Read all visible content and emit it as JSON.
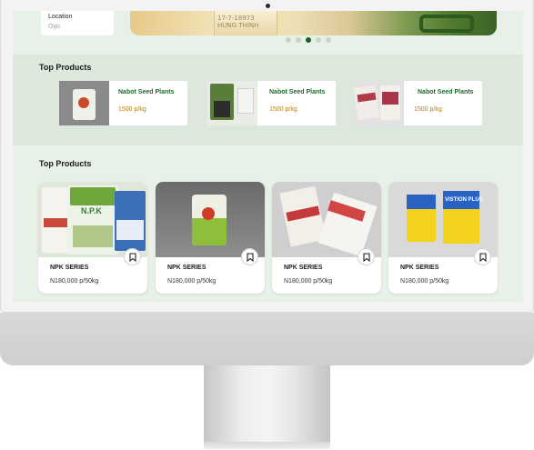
{
  "location": {
    "label": "Location",
    "value": "Oyo"
  },
  "banner": {
    "text_line1": "17-7-18973",
    "text_line2": "HUNG THINH"
  },
  "carousel": {
    "dot_count": 5,
    "active_index": 2
  },
  "top_products_featured": {
    "title": "Top Products",
    "items": [
      {
        "name": "Nabot Seed Plants",
        "price": "1500 p/kg"
      },
      {
        "name": "Nabot Seed Plants",
        "price": "1500 p/kg"
      },
      {
        "name": "Nabot Seed Plants",
        "price": "1500 p/kg"
      }
    ]
  },
  "top_products_grid": {
    "title": "Top Products",
    "items": [
      {
        "name": "NPK SERIES",
        "price": "N180,000 p/50kg",
        "image_text": "N.P.K"
      },
      {
        "name": "NPK SERIES",
        "price": "N180,000 p/50kg",
        "image_text": ""
      },
      {
        "name": "NPK SERIES",
        "price": "N180,000 p/50kg",
        "image_text": ""
      },
      {
        "name": "NPK SERIES",
        "price": "N180,000 p/50kg",
        "image_text": "VISTION PLUS"
      }
    ]
  },
  "colors": {
    "brand_green": "#1f6a2e",
    "price_orange": "#b87b12",
    "page_bg": "#e7f1e7",
    "band_bg": "#dde8dd"
  }
}
